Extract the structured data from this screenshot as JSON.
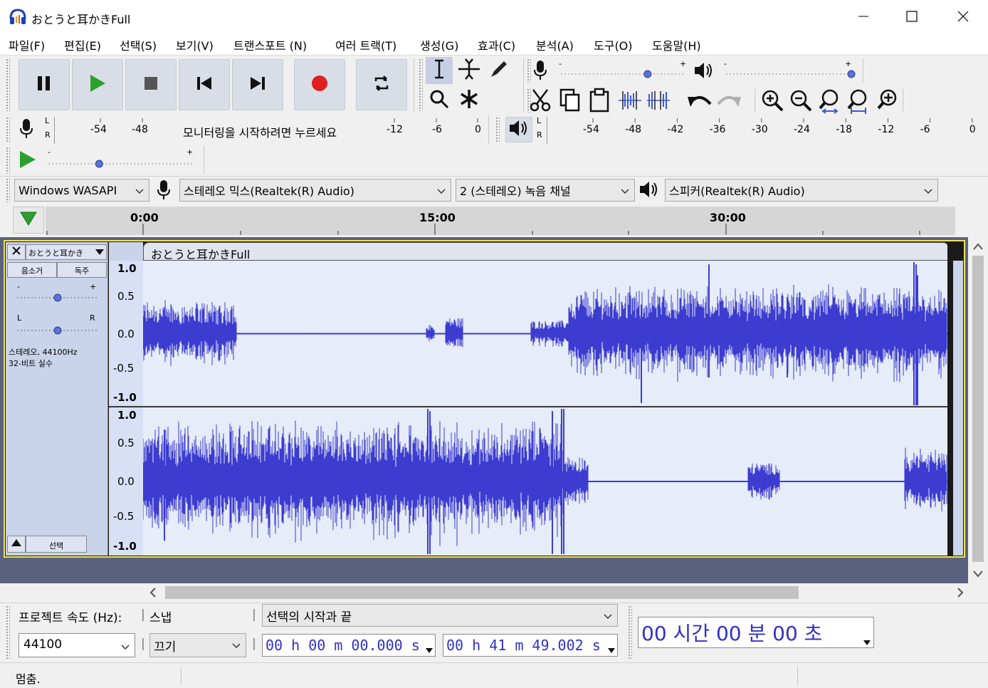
{
  "window": {
    "title": "おとうと耳かきFull"
  },
  "menu": [
    {
      "label": "파일(F)"
    },
    {
      "label": "편집(E)"
    },
    {
      "label": "선택(S)"
    },
    {
      "label": "보기(V)"
    },
    {
      "label": "트랜스포트 (N)"
    },
    {
      "label": "여러 트랙(T)"
    },
    {
      "label": "생성(G)"
    },
    {
      "label": "효과(C)"
    },
    {
      "label": "분석(A)"
    },
    {
      "label": "도구(O)"
    },
    {
      "label": "도움말(H)"
    }
  ],
  "transport": {
    "buttons": [
      "pause-icon",
      "play-icon",
      "stop-icon",
      "skip-start-icon",
      "skip-end-icon",
      "record-icon",
      "loop-icon"
    ],
    "play_color": "#2ca02c",
    "record_color": "#e02020"
  },
  "record_meter": {
    "channels": [
      "L",
      "R"
    ],
    "ticks_left": [
      "-54",
      "-48"
    ],
    "monitor_prompt": "모니터링을 시작하려면 누르세요",
    "ticks_right": [
      "-12",
      "-6",
      "0"
    ]
  },
  "play_meter": {
    "channels": [
      "L",
      "R"
    ],
    "ticks": [
      "-54",
      "-48",
      "-42",
      "-36",
      "-30",
      "-24",
      "-18",
      "-12",
      "-6",
      "0"
    ]
  },
  "sliders": {
    "minus": "-",
    "plus": "+",
    "record_volume": 0.7,
    "play_volume": 1.0,
    "play_speed": 0.35
  },
  "device": {
    "host": "Windows WASAPI",
    "recording_device": "스테레오 믹스(Realtek(R) Audio)",
    "channels": "2 (스테레오) 녹음 채널",
    "playback_device": "스피커(Realtek(R) Audio)"
  },
  "timeline": {
    "labels": [
      "0:00",
      "15:00",
      "30:00"
    ]
  },
  "track": {
    "name": "おとうと耳かき",
    "clip_name": "おとうと耳かきFull",
    "mute_label": "음소거",
    "solo_label": "독주",
    "gain_minus": "-",
    "gain_plus": "+",
    "pan_left": "L",
    "pan_right": "R",
    "gain_value": 0.5,
    "pan_value": 0.5,
    "info_line1": "스테레오, 44100Hz",
    "info_line2": "32-비트 실수",
    "select_label": "선택",
    "scale_labels": [
      "1.0",
      "0.5",
      "0.0",
      "-0.5",
      "-1.0"
    ],
    "wave_color": "#3c3cd0"
  },
  "selection_toolbar": {
    "rate_label": "프로젝트 속도 (Hz):",
    "snap_label": "스냅",
    "rate_value": "44100",
    "snap_value": "끄기",
    "selection_mode": "선택의 시작과 끝",
    "start_time": "00 h 00 m 00.000 s",
    "end_time": "00 h 41 m 49.002 s"
  },
  "time_display": {
    "value": "00 시간 00 분 00 초"
  },
  "status": {
    "text": "멈춤."
  }
}
